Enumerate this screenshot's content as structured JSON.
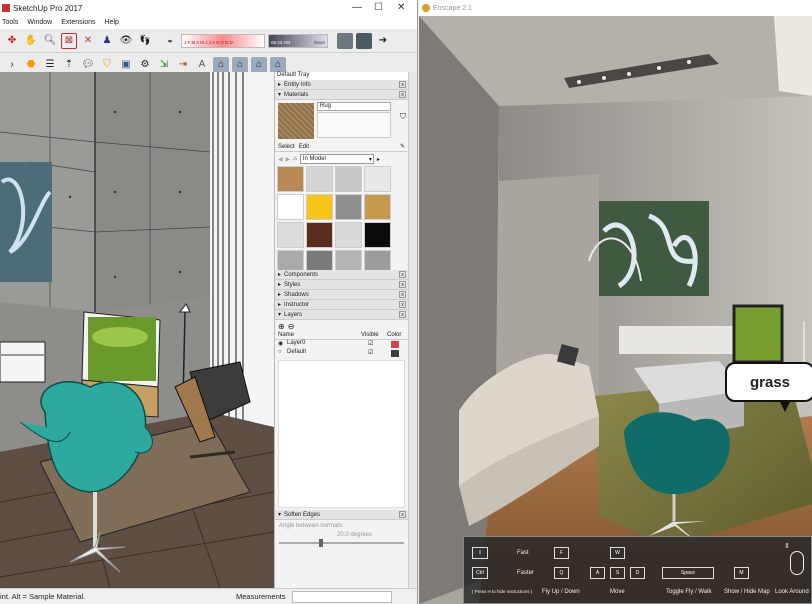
{
  "sketchup": {
    "title": "SketchUp Pro 2017",
    "menu": [
      "Tools",
      "Window",
      "Extensions",
      "Help"
    ],
    "time_readout": "06:43 AM",
    "time_label": "Noon",
    "shadow_months": "J F M A M J J A S O N D",
    "tray": {
      "title": "Default Tray",
      "entity_info": "Entity Info",
      "materials": "Materials",
      "material_name": "Rug",
      "tab_select": "Select",
      "tab_edit": "Edit",
      "library": "In Model",
      "components": "Components",
      "styles": "Styles",
      "shadows": "Shadows",
      "instructor": "Instructor",
      "layers": "Layers",
      "layers_cols": {
        "name": "Name",
        "visible": "Visible",
        "color": "Color"
      },
      "layer_rows": [
        {
          "name": "Layer0",
          "color": "#d8434b"
        },
        {
          "name": "Default",
          "color": "#3d3d3d"
        }
      ],
      "soften": "Soften Edges",
      "angle_label": "Angle between normals:",
      "angle_value": "20.0  degrees"
    },
    "status_hint": "int. Alt = Sample Material.",
    "measurements": "Measurements",
    "swatch_colors": [
      "#b78a55",
      "#d4d4d4",
      "#c8c8c8",
      "#e9e9e9",
      "#ffffff",
      "#f5c518",
      "#8f8f8f",
      "#c59a4f",
      "#dcdcdc",
      "#5a2c20",
      "#dadada",
      "#0b0b0b",
      "#aaaaaa",
      "#7a7a7a",
      "#b5b5b5",
      "#9c9c9c"
    ]
  },
  "enscape": {
    "title": "Enscape 2.1",
    "bubble_text": "grass",
    "hud": {
      "fast": "Fast",
      "faster": "Faster",
      "shift_key": "⇧",
      "ctrl_key": "Ctrl",
      "f_key": "F",
      "q_key": "Q",
      "w_key": "W",
      "a_key": "A",
      "s_key": "S",
      "d_key": "D",
      "space_key": "Space",
      "m_key": "M",
      "press_hint": "( Press H to hide instructions )",
      "fly_up_down": "Fly Up / Down",
      "move": "Move",
      "toggle_fly_walk": "Toggle Fly / Walk",
      "show_hide_map": "Show / Hide Map",
      "look_around": "Look Around"
    }
  }
}
